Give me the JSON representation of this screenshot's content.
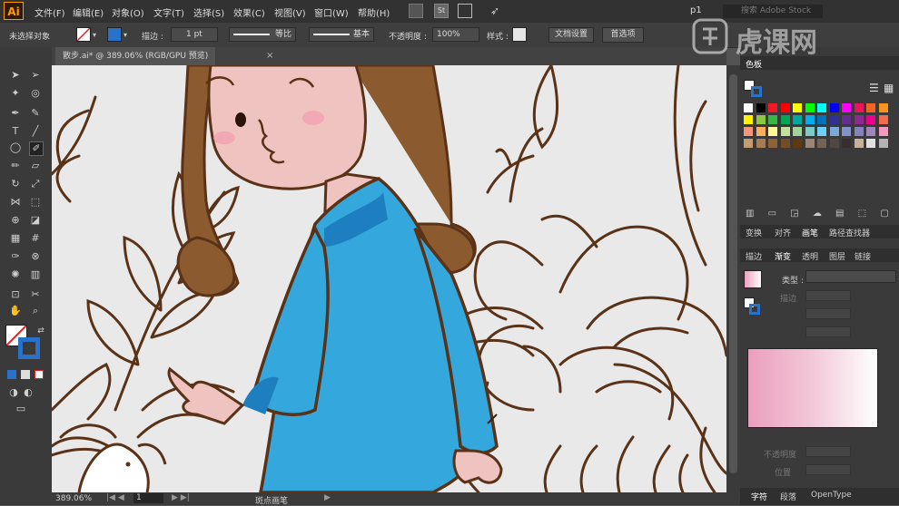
{
  "app": {
    "logo": "Ai"
  },
  "menu": [
    "文件(F)",
    "编辑(E)",
    "对象(O)",
    "文字(T)",
    "选择(S)",
    "效果(C)",
    "视图(V)",
    "窗口(W)",
    "帮助(H)"
  ],
  "menubar_right": {
    "workspace": "p1",
    "search_placeholder": "搜索 Adobe Stock"
  },
  "controlbar": {
    "selection_status": "未选择对象",
    "stroke_label": "描边 :",
    "stroke_weight": "1 pt",
    "profile_label": "等比",
    "brush_label": "基本",
    "opacity_label": "不透明度 :",
    "opacity_value": "100%",
    "style_label": "样式 :",
    "doc_setup_button": "文档设置",
    "preferences_button": "首选项"
  },
  "document_tab": {
    "label": "散步.ai* @ 389.06% (RGB/GPU 预览)"
  },
  "statusbar": {
    "zoom": "389.06%",
    "artboard": "1",
    "tool": "斑点画笔"
  },
  "panels": {
    "swatches_tab": "色板",
    "align_tabs": [
      "变换",
      "对齐",
      "画笔",
      "路径查找器"
    ],
    "gradient_tabs": [
      "描边",
      "渐变",
      "透明",
      "图层",
      "链接"
    ],
    "gradient_type_label": "类型 :",
    "gradient_fields": [
      "描边",
      "不透明度",
      "位置"
    ],
    "bottom_tabs": [
      "字符",
      "段落",
      "OpenType"
    ]
  },
  "watermark": {
    "text": "虎课网"
  },
  "colors": {
    "accent": "#ff9a00",
    "skin": "#efc3bf",
    "hair": "#8b5a2e",
    "outline": "#5a3217",
    "dress": "#34a7dd",
    "dress_shadow": "#1d7fc0",
    "gradient_pink": "#eb9fbd"
  },
  "swatch_colors": [
    "#ffffff",
    "#000000",
    "#ed1c24",
    "#ff0000",
    "#ffff00",
    "#00ff00",
    "#00ffff",
    "#0000ff",
    "#ff00ff",
    "#ed145b",
    "#f26522",
    "#f7941d",
    "#fff200",
    "#8dc63f",
    "#39b54a",
    "#00a651",
    "#00a99d",
    "#00aeef",
    "#0072bc",
    "#2e3192",
    "#662d91",
    "#92278f",
    "#ec008c",
    "#f26c4f",
    "#f69679",
    "#fbaf5d",
    "#fff799",
    "#c4df9b",
    "#a3d39c",
    "#7accc8",
    "#6dcff6",
    "#7da7d9",
    "#8393ca",
    "#8781bd",
    "#a186be",
    "#f49ac1",
    "#c69c6d",
    "#a67c52",
    "#8c6239",
    "#754c24",
    "#603913",
    "#998675",
    "#736357",
    "#534741",
    "#362f2d",
    "#c7b299",
    "#e0e0e0",
    "#b3b3b3"
  ]
}
